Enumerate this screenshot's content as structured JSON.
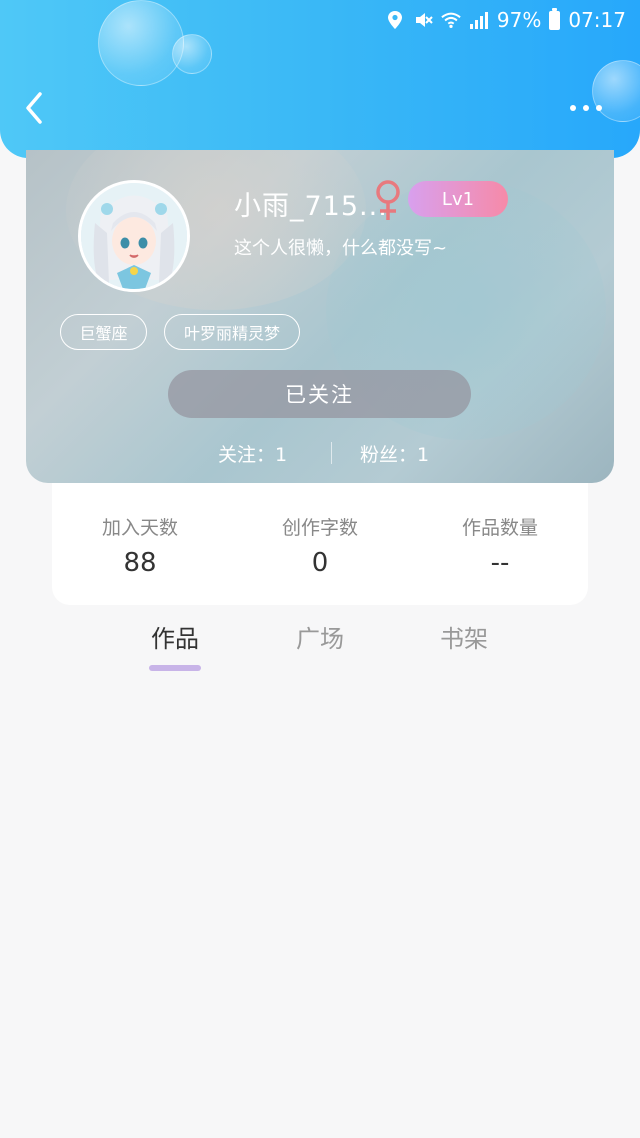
{
  "status_bar": {
    "battery": "97%",
    "time": "07:17",
    "icons": [
      "location-icon",
      "mute-icon",
      "wifi-icon",
      "signal-icon",
      "battery-icon"
    ]
  },
  "nav": {
    "back_icon": "back-arrow-icon",
    "more_icon": "more-dots-icon"
  },
  "profile": {
    "username": "小雨_715...",
    "gender": "female",
    "gender_symbol": "♀",
    "level": "Lv1",
    "bio": "这个人很懒，什么都没写~",
    "tags": [
      "巨蟹座",
      "叶罗丽精灵梦"
    ],
    "follow_button": "已关注",
    "following": "关注：1",
    "fans": "粉丝：1"
  },
  "stats": [
    {
      "label": "加入天数",
      "value": "88"
    },
    {
      "label": "创作字数",
      "value": "0"
    },
    {
      "label": "作品数量",
      "value": "--"
    }
  ],
  "tabs": [
    {
      "label": "作品",
      "active": true
    },
    {
      "label": "广场",
      "active": false
    },
    {
      "label": "书架",
      "active": false
    }
  ],
  "colors": {
    "header_gradient_start": "#4fc8f7",
    "header_gradient_end": "#27a8fb",
    "level_badge_start": "#d8a0ee",
    "level_badge_end": "#f68aa8",
    "gender_color": "#e8797e",
    "tab_indicator": "#c8b4e8"
  }
}
